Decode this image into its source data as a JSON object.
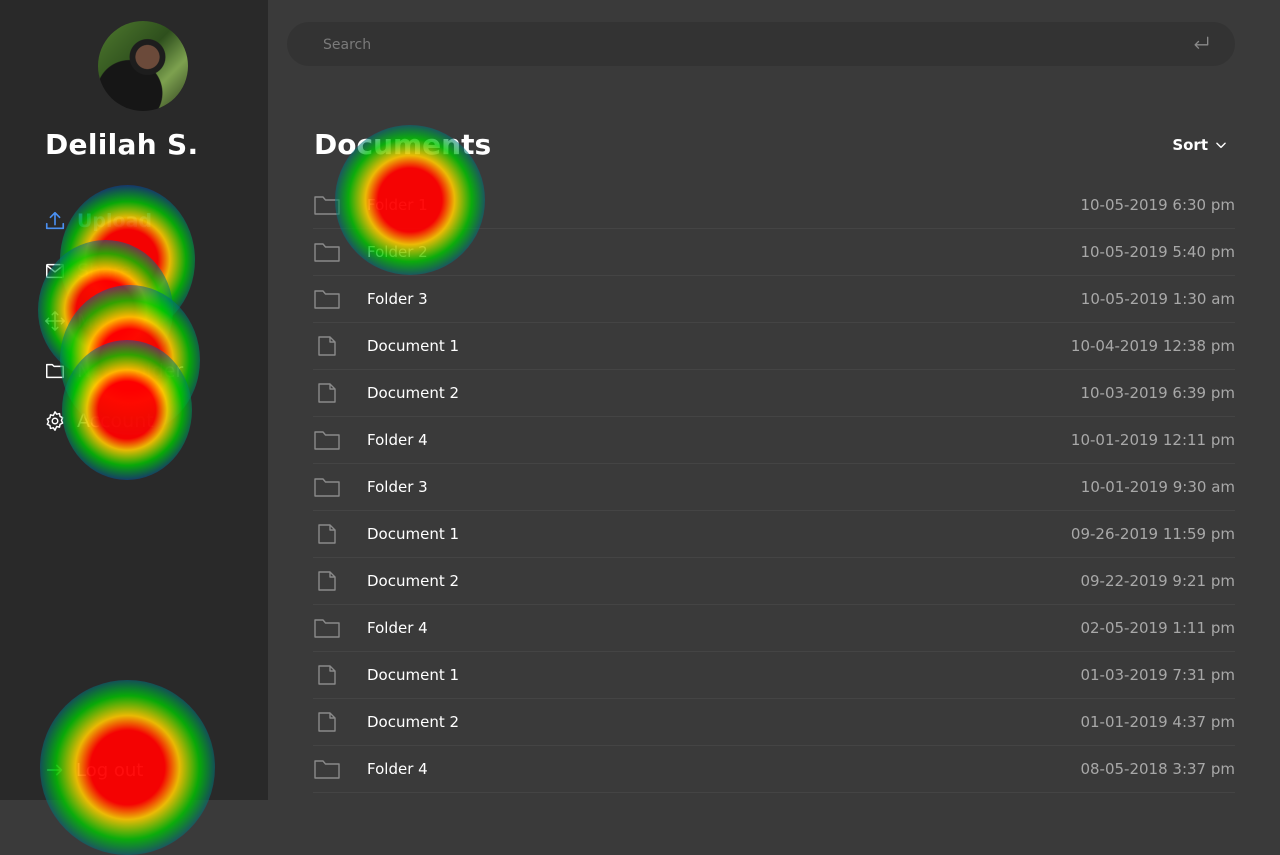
{
  "user": {
    "name": "Delilah S."
  },
  "nav": {
    "items": [
      {
        "label": "Upload",
        "icon": "upload-icon",
        "active": true
      },
      {
        "label": "Share",
        "icon": "mail-icon",
        "active": false
      },
      {
        "label": "Move",
        "icon": "move-icon",
        "active": false
      },
      {
        "label": "New Folder",
        "icon": "folder-icon",
        "active": false
      },
      {
        "label": "Account",
        "icon": "gear-icon",
        "active": false
      }
    ],
    "logout": {
      "label": "Log out",
      "icon": "arrow-right-icon"
    }
  },
  "search": {
    "placeholder": "Search",
    "icon": "enter-icon"
  },
  "main": {
    "title": "Documents",
    "sort_label": "Sort",
    "files": [
      {
        "name": "Folder 1",
        "type": "folder",
        "date": "10-05-2019 6:30 pm"
      },
      {
        "name": "Folder 2",
        "type": "folder",
        "date": "10-05-2019 5:40 pm"
      },
      {
        "name": "Folder 3",
        "type": "folder",
        "date": "10-05-2019 1:30 am"
      },
      {
        "name": "Document 1",
        "type": "document",
        "date": "10-04-2019 12:38 pm"
      },
      {
        "name": "Document 2",
        "type": "document",
        "date": "10-03-2019 6:39 pm"
      },
      {
        "name": "Folder 4",
        "type": "folder",
        "date": "10-01-2019 12:11 pm"
      },
      {
        "name": "Folder 3",
        "type": "folder",
        "date": "10-01-2019 9:30 am"
      },
      {
        "name": "Document 1",
        "type": "document",
        "date": "09-26-2019 11:59 pm"
      },
      {
        "name": "Document 2",
        "type": "document",
        "date": "09-22-2019 9:21 pm"
      },
      {
        "name": "Folder 4",
        "type": "folder",
        "date": "02-05-2019 1:11 pm"
      },
      {
        "name": "Document 1",
        "type": "document",
        "date": "01-03-2019 7:31 pm"
      },
      {
        "name": "Document 2",
        "type": "document",
        "date": "01-01-2019 4:37 pm"
      },
      {
        "name": "Folder 4",
        "type": "folder",
        "date": "08-05-2018 3:37 pm"
      }
    ]
  },
  "colors": {
    "accent": "#4a8ff0",
    "sidebar": "#292929",
    "background": "#3a3a3a"
  }
}
